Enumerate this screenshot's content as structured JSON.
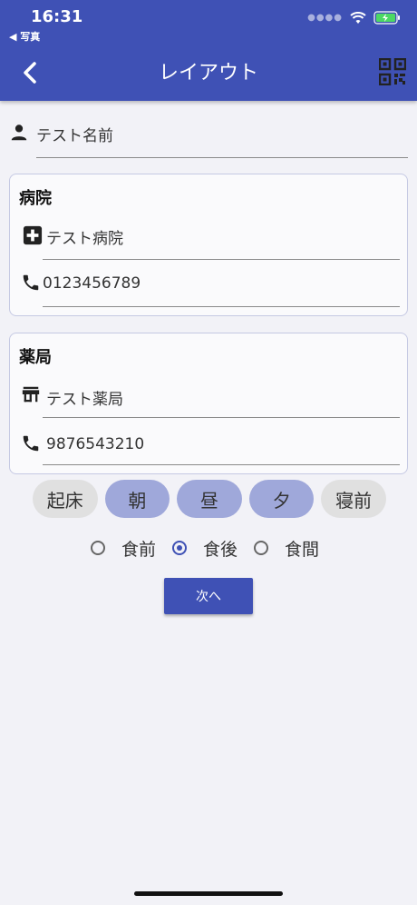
{
  "status": {
    "time": "16:31",
    "back_app": "◀ 写真"
  },
  "nav": {
    "title": "レイアウト",
    "back_icon": "chevron-left-icon",
    "qr_icon": "qr-code-icon"
  },
  "name_field": {
    "icon": "person-icon",
    "value": "テスト名前"
  },
  "hospital": {
    "title": "病院",
    "name_icon": "hospital-cross-icon",
    "name": "テスト病院",
    "phone_icon": "phone-icon",
    "phone": "0123456789"
  },
  "pharmacy": {
    "title": "薬局",
    "name_icon": "store-icon",
    "name": "テスト薬局",
    "phone_icon": "phone-icon",
    "phone": "9876543210"
  },
  "timing_chips": [
    {
      "label": "起床",
      "selected": false
    },
    {
      "label": "朝",
      "selected": true
    },
    {
      "label": "昼",
      "selected": true
    },
    {
      "label": "夕",
      "selected": true
    },
    {
      "label": "寝前",
      "selected": false
    }
  ],
  "meal_options": [
    {
      "label": "食前",
      "selected": false
    },
    {
      "label": "食後",
      "selected": true
    },
    {
      "label": "食間",
      "selected": false
    }
  ],
  "next_button": "次へ",
  "colors": {
    "primary": "#3f51b5",
    "chip_selected": "#9fa8da",
    "chip_unselected": "#e0e0e0",
    "background": "#f2f2f7"
  }
}
